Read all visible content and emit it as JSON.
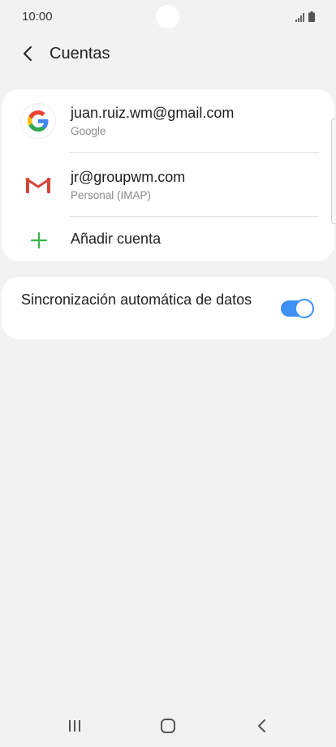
{
  "status_bar": {
    "time": "10:00",
    "icons": [
      "signal-icon",
      "battery-icon"
    ]
  },
  "header": {
    "title": "Cuentas",
    "back_icon": "chevron-left-icon"
  },
  "accounts": [
    {
      "email": "juan.ruiz.wm@gmail.com",
      "type": "Google",
      "icon": "google-icon"
    },
    {
      "email": "jr@groupwm.com",
      "type": "Personal (IMAP)",
      "icon": "gmail-icon"
    }
  ],
  "add_account": {
    "label": "Añadir cuenta",
    "icon": "plus-icon"
  },
  "sync": {
    "label": "Sincronización automática de datos",
    "enabled": true
  },
  "colors": {
    "background": "#f2f2f2",
    "card": "#ffffff",
    "accent_blue": "#3e91f2",
    "add_green": "#3bb54a",
    "gmail_red": "#d44638"
  },
  "nav_bar": {
    "icons": [
      "recents-icon",
      "home-icon",
      "back-icon"
    ]
  }
}
